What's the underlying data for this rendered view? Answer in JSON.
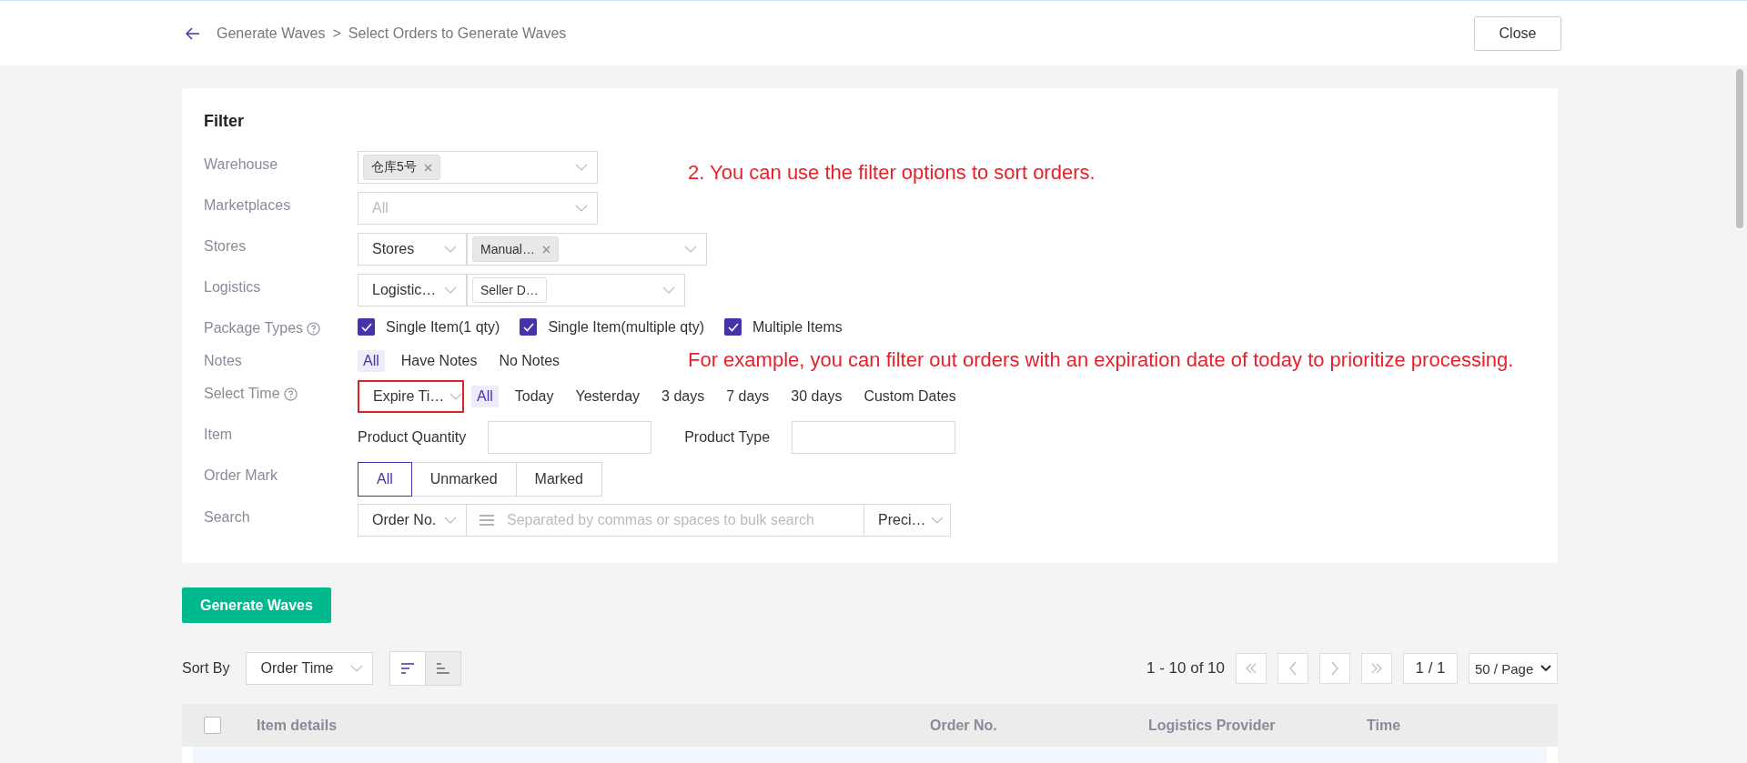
{
  "breadcrumb": {
    "parent": "Generate Waves",
    "separator": ">",
    "current": "Select Orders to Generate Waves"
  },
  "close_button": "Close",
  "filter": {
    "title": "Filter",
    "warehouse": {
      "label": "Warehouse",
      "tags": [
        {
          "text": "仓库5号",
          "removable": true
        }
      ]
    },
    "marketplaces": {
      "label": "Marketplaces",
      "placeholder": "All"
    },
    "stores": {
      "label": "Stores",
      "type_value": "Stores",
      "tags": [
        {
          "text": "Manual…",
          "removable": true
        }
      ]
    },
    "logistics": {
      "label": "Logistics",
      "type_value": "Logistic…",
      "tags": [
        {
          "text": "Seller D…",
          "removable": false
        }
      ]
    },
    "package_types": {
      "label": "Package Types",
      "options": [
        {
          "label": "Single Item(1 qty)",
          "checked": true
        },
        {
          "label": "Single Item(multiple qty)",
          "checked": true
        },
        {
          "label": "Multiple Items",
          "checked": true
        }
      ]
    },
    "notes": {
      "label": "Notes",
      "options": [
        {
          "label": "All",
          "selected": true
        },
        {
          "label": "Have Notes",
          "selected": false
        },
        {
          "label": "No Notes",
          "selected": false
        }
      ]
    },
    "select_time": {
      "label": "Select Time",
      "field": "Expire Ti…",
      "highlighted": true,
      "options": [
        {
          "label": "All",
          "selected": true
        },
        {
          "label": "Today",
          "selected": false
        },
        {
          "label": "Yesterday",
          "selected": false
        },
        {
          "label": "3 days",
          "selected": false
        },
        {
          "label": "7 days",
          "selected": false
        },
        {
          "label": "30 days",
          "selected": false
        },
        {
          "label": "Custom Dates",
          "selected": false
        }
      ]
    },
    "item": {
      "label": "Item",
      "fields": [
        {
          "label": "Product Quantity"
        },
        {
          "label": "Product Type"
        }
      ]
    },
    "order_mark": {
      "label": "Order Mark",
      "options": [
        {
          "label": "All",
          "selected": true
        },
        {
          "label": "Unmarked",
          "selected": false
        },
        {
          "label": "Marked",
          "selected": false
        }
      ]
    },
    "search": {
      "label": "Search",
      "field": "Order No.",
      "placeholder": "Separated by commas or spaces to bulk search",
      "mode": "Preci…"
    }
  },
  "annotations": [
    "2. You can use the filter options to sort orders.",
    "For example, you can filter out orders with an expiration date of today to prioritize processing."
  ],
  "generate_button": "Generate Waves",
  "sort": {
    "label": "Sort By",
    "field": "Order Time",
    "directions": [
      {
        "kind": "desc",
        "selected": true
      },
      {
        "kind": "asc",
        "selected": false
      }
    ]
  },
  "pagination": {
    "range": "1 - 10 of 10",
    "page": "1 / 1",
    "page_size": "50 / Page"
  },
  "table": {
    "select_all_checked": false,
    "columns": [
      "Item details",
      "Order No.",
      "Logistics Provider",
      "Time"
    ]
  }
}
